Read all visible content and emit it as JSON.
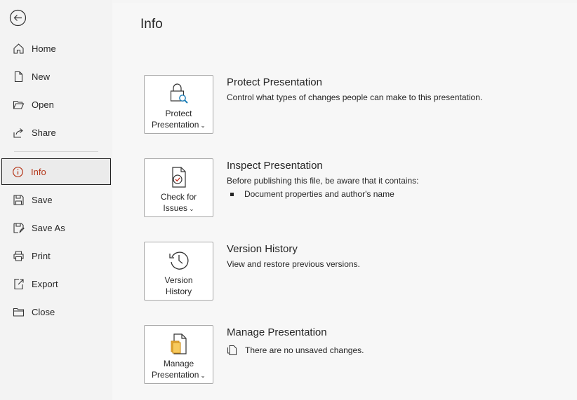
{
  "sidebar": {
    "items": [
      {
        "label": "Home",
        "icon": "home-icon"
      },
      {
        "label": "New",
        "icon": "new-document-icon"
      },
      {
        "label": "Open",
        "icon": "folder-open-icon"
      },
      {
        "label": "Share",
        "icon": "share-icon"
      },
      {
        "label": "Info",
        "icon": "info-icon",
        "active": true
      },
      {
        "label": "Save",
        "icon": "save-icon"
      },
      {
        "label": "Save As",
        "icon": "save-as-icon"
      },
      {
        "label": "Print",
        "icon": "print-icon"
      },
      {
        "label": "Export",
        "icon": "export-icon"
      },
      {
        "label": "Close",
        "icon": "close-folder-icon"
      }
    ]
  },
  "main": {
    "title": "Info",
    "sections": [
      {
        "button_line1": "Protect",
        "button_line2": "Presentation",
        "chevron": "⌄",
        "title": "Protect Presentation",
        "desc": "Control what types of changes people can make to this presentation."
      },
      {
        "button_line1": "Check for",
        "button_line2": "Issues",
        "chevron": "⌄",
        "title": "Inspect Presentation",
        "desc": "Before publishing this file, be aware that it contains:",
        "bullet": "Document properties and author's name"
      },
      {
        "button_line1": "Version",
        "button_line2": "History",
        "title": "Version History",
        "desc": "View and restore previous versions."
      },
      {
        "button_line1": "Manage",
        "button_line2": "Presentation",
        "chevron": "⌄",
        "title": "Manage Presentation",
        "status": "There are no unsaved changes."
      }
    ]
  },
  "colors": {
    "accent": "#b5371a",
    "border": "#a9a9a9"
  }
}
